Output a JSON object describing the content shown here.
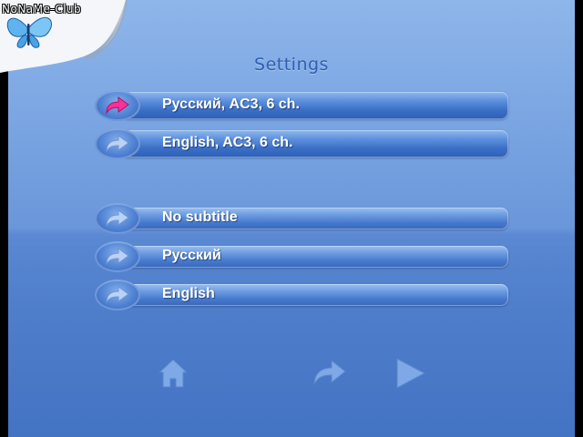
{
  "watermark": {
    "text": "NoNaMe-Club"
  },
  "title": "Settings",
  "audio_tracks": [
    {
      "label": "Русский, AC3, 6 ch.",
      "selected": true
    },
    {
      "label": "English, AC3, 6 ch.",
      "selected": false
    }
  ],
  "subtitles": [
    {
      "label": "No subtitle",
      "selected": false
    },
    {
      "label": "Русский",
      "selected": false
    },
    {
      "label": "English",
      "selected": false
    }
  ],
  "nav": {
    "home": "home-icon",
    "next": "arrow-right-icon",
    "play": "play-icon"
  },
  "colors": {
    "selected_arrow": "#ff2f9a",
    "normal_arrow": "#b9d2f5",
    "title": "#2f5fb0"
  }
}
